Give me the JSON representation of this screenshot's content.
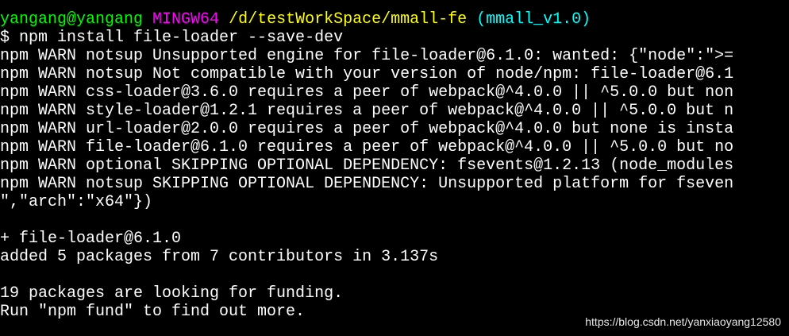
{
  "prompt": {
    "user_host": "yangang@yangang",
    "system": "MINGW64",
    "path": "/d/testWorkSpace/mmall-fe",
    "branch": "(mmall_v1.0)"
  },
  "command": "$ npm install file-loader --save-dev",
  "output_lines": [
    "npm WARN notsup Unsupported engine for file-loader@6.1.0: wanted: {\"node\":\">=",
    "npm WARN notsup Not compatible with your version of node/npm: file-loader@6.1",
    "npm WARN css-loader@3.6.0 requires a peer of webpack@^4.0.0 || ^5.0.0 but non",
    "npm WARN style-loader@1.2.1 requires a peer of webpack@^4.0.0 || ^5.0.0 but n",
    "npm WARN url-loader@2.0.0 requires a peer of webpack@^4.0.0 but none is insta",
    "npm WARN file-loader@6.1.0 requires a peer of webpack@^4.0.0 || ^5.0.0 but no",
    "npm WARN optional SKIPPING OPTIONAL DEPENDENCY: fsevents@1.2.13 (node_modules",
    "npm WARN notsup SKIPPING OPTIONAL DEPENDENCY: Unsupported platform for fseven",
    "\",\"arch\":\"x64\"})"
  ],
  "result": {
    "installed": "+ file-loader@6.1.0",
    "added": "added 5 packages from 7 contributors in 3.137s"
  },
  "funding": {
    "line1": "19 packages are looking for funding.",
    "line2": "Run \"npm fund\" to find out more."
  },
  "watermark": "https://blog.csdn.net/yanxiaoyang12580",
  "colors": {
    "background": "#000000",
    "text": "#ffffff",
    "user_host": "#00ff00",
    "system": "#ff00ff",
    "path": "#ffff00",
    "branch": "#00ffff"
  }
}
